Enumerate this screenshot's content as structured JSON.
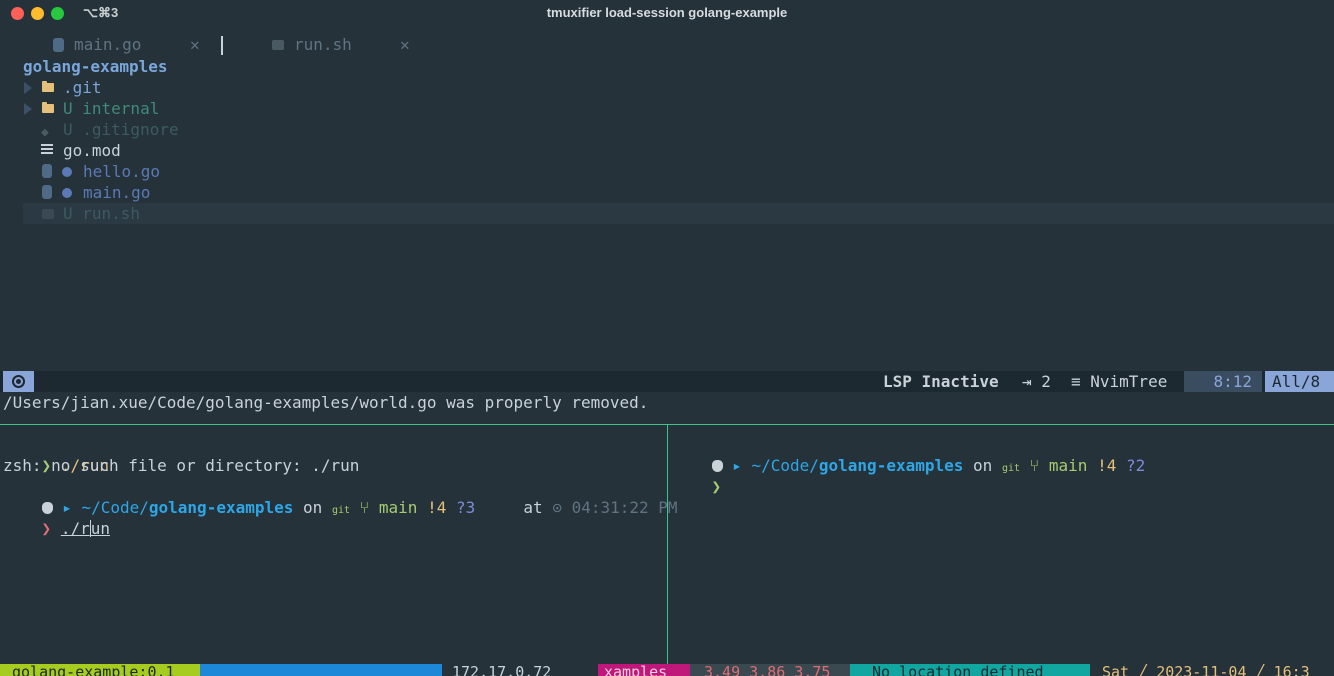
{
  "window": {
    "title": "tmuxifier load-session golang-example",
    "shortcut": "⌥⌘3"
  },
  "tabs": [
    {
      "label": "main.go",
      "close": "✕"
    },
    {
      "label": "run.sh",
      "close": "✕"
    }
  ],
  "tree": {
    "root": "golang-examples",
    "items": [
      {
        "label": ".git",
        "type": "folder",
        "git": ""
      },
      {
        "label": "U internal",
        "type": "folder",
        "git": "U"
      },
      {
        "label": "U .gitignore",
        "type": "gear",
        "git": "U"
      },
      {
        "label": "go.mod",
        "type": "text",
        "git": ""
      },
      {
        "label": "hello.go",
        "type": "go",
        "git": "modified"
      },
      {
        "label": "main.go",
        "type": "go",
        "git": "modified"
      },
      {
        "label": "U run.sh",
        "type": "shell",
        "git": "U"
      }
    ]
  },
  "statusline": {
    "lsp": "LSP Inactive",
    "indent": "⇥ 2",
    "filetype": "≡ NvimTree",
    "position": "8:12",
    "scroll": "All/8"
  },
  "message": "/Users/jian.xue/Code/golang-examples/world.go was properly removed.",
  "left_pane": {
    "line1_prompt": "❯",
    "line1_cmd": "./run",
    "line2": "zsh: no such file or directory: ./run",
    "path_prefix": "~/Code/",
    "path_dir": "golang-examples",
    "on": "on",
    "git_label": "git",
    "branch": "main",
    "modified": "!4",
    "untracked": "?3",
    "at": "at",
    "time": "04:31:22 PM",
    "line4_prompt": "❯",
    "line4_cmd_a": "./r",
    "line4_cmd_b": "un"
  },
  "right_pane": {
    "path_prefix": "~/Code/",
    "path_dir": "golang-examples",
    "on": "on",
    "git_label": "git",
    "branch": "main",
    "modified": "!4",
    "untracked": "?2",
    "prompt": "❯"
  },
  "tmux_status": {
    "session": "golang-example:0.1",
    "ip": "172.17.0.72",
    "window": "xamples",
    "load": "3.49 3.86 3.75",
    "location": "No location defined",
    "day": "Sat",
    "date": "2023-11-04",
    "time": "16:3"
  },
  "colors": {
    "background": "#25323a",
    "accent": "#8aa6d8",
    "pane_border": "#3fc28c"
  }
}
